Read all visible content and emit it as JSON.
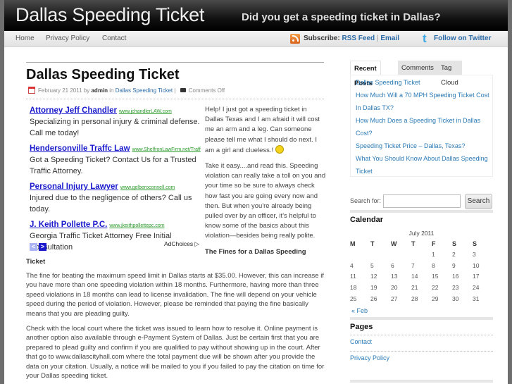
{
  "header": {
    "site_title": "Dallas Speeding Ticket",
    "tagline": "Did you get a speeding ticket in Dallas?"
  },
  "nav": {
    "items": [
      "Home",
      "Privacy Policy",
      "Contact"
    ],
    "subscribe_label": "Subscribe:",
    "rss_label": "RSS Feed",
    "separator": "|",
    "email_label": "Email",
    "twitter_label": "Follow on Twitter",
    "icons": {
      "rss": "rss-icon",
      "twitter": "twitter-icon"
    }
  },
  "post": {
    "title": "Dallas Speeding Ticket",
    "date": "February 21 2011",
    "by": "by",
    "author": "admin",
    "in": "in",
    "category": "Dallas Speeding Ticket",
    "meta_sep": "|",
    "comments": "Comments Off",
    "intro_question": "Help! I just got a speeding ticket in Dallas Texas and I am afraid it will cost me an arm and a leg. Can someone please tell me what I should do next. I am a girl and clueless.!",
    "intro_answer": "Take it easy....and read this. Speeding violation can really take a toll on you and your time so be sure to always check how fast you are going every now and then. But when you're already being pulled over by an officer, it's helpful to know some of the basics about this violation—besides being really polite.",
    "fines_heading_part1": "The Fines for a Dallas Speeding",
    "fines_heading_part2": "Ticket",
    "paragraph1": "The fine for beating the maximum speed limit in Dallas starts at $35.00. However, this can increase if you have more than one speeding violation within 18 months. Furthermore, having more than three speed violations in 18 months can lead to license invalidation. The fine will depend on your vehicle speed during the period of violation. However, please be reminded that paying the fine basically means that you are pleading guilty.",
    "paragraph2": "Check with the local court where the ticket was issued to learn how to resolve it. Online payment is another option also available through e-Payment System of Dallas. Just be certain first that you are prepared to plead guilty and confirm if you are qualified to pay without showing up in the court. After that go to www.dallascityhall.com where the total payment due will be shown after you provide the data on your citation. Usually, a notice will be mailed to you if you failed to pay the citation on time for your Dallas speeding ticket."
  },
  "ads": {
    "items": [
      {
        "title": "Attorney Jeff Chandler",
        "url": "www.jchandlerLAW.com",
        "desc": "Specializing in personal injury & criminal defense. Call me today!"
      },
      {
        "title": "Hendersonville Traffc Law",
        "url": "www.ShelfronLawFirm.net/Traff",
        "desc": "Got a Speeding Ticket? Contact Us for a Trusted Traffic Attorney."
      },
      {
        "title": "Personal Injury Lawyer",
        "url": "www.gelberoconnell.com",
        "desc": "Injured due to the negligence of others? Call us today."
      },
      {
        "title": "J. Keith Pollette P.C.",
        "url": "www.jkeithpollettepc.com",
        "desc": "Georgia Traffic Ticket Attorney Free Initial Consultation"
      }
    ],
    "prev": "<",
    "next": ">",
    "adchoices": "AdChoices ▷"
  },
  "sidebar": {
    "tabs": [
      "Recent Posts",
      "Comments",
      "Tag Cloud"
    ],
    "recent_posts": [
      "Dallas Speeding Ticket",
      "How Much Will a 70 MPH Speeding Ticket Cost In Dallas TX?",
      "How Much Does a Speeding Ticket in Dallas Cost?",
      "Speeding Ticket Price – Dallas, Texas?",
      "What You Should Know About Dallas Speeding Ticket"
    ],
    "search_label": "Search for:",
    "search_value": "",
    "search_button": "Search",
    "calendar_title": "Calendar",
    "calendar_caption": "July 2011",
    "calendar_days": [
      "M",
      "T",
      "W",
      "T",
      "F",
      "S",
      "S"
    ],
    "calendar_weeks": [
      [
        "",
        "",
        "",
        "",
        "1",
        "2",
        "3"
      ],
      [
        "4",
        "5",
        "6",
        "7",
        "8",
        "9",
        "10"
      ],
      [
        "11",
        "12",
        "13",
        "14",
        "15",
        "16",
        "17"
      ],
      [
        "18",
        "19",
        "20",
        "21",
        "22",
        "23",
        "24"
      ],
      [
        "25",
        "26",
        "27",
        "28",
        "29",
        "30",
        "31"
      ]
    ],
    "calendar_prev": "« Feb",
    "pages_title": "Pages",
    "pages": [
      "Contact",
      "Privacy Policy"
    ]
  }
}
